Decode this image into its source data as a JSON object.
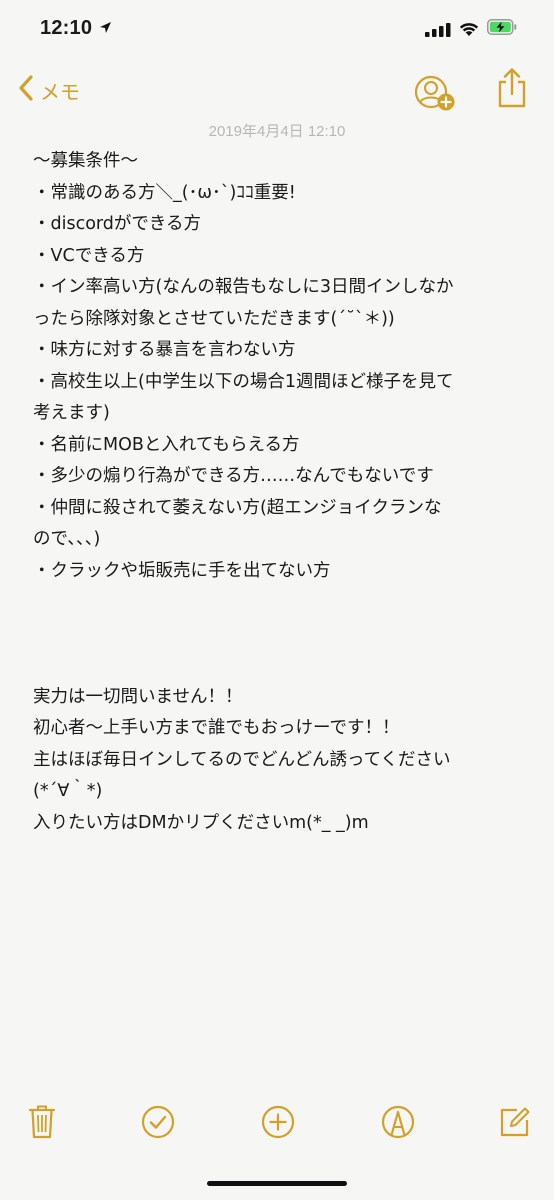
{
  "status_bar": {
    "time": "12:10",
    "icons": [
      "location-arrow-icon",
      "signal-bars-icon",
      "wifi-icon",
      "battery-charging-icon"
    ]
  },
  "nav": {
    "back_label": "メモ",
    "accent_color": "#d3a02a",
    "icons": [
      "chevron-left-icon",
      "add-people-icon",
      "share-icon"
    ]
  },
  "note": {
    "timestamp": "2019年4月4日 12:10",
    "lines": [
      "〜募集条件〜",
      "・常識のある方＼_(･ω･`)ｺｺ重要!",
      "・discordができる方",
      "・VCできる方",
      "・イン率高い方(なんの報告もなしに3日間インしなか",
      "ったら除隊対象とさせていただきます(´˘`＊))",
      "・味方に対する暴言を言わない方",
      "・高校生以上(中学生以下の場合1週間ほど様子を見て",
      "考えます)",
      "・名前にMOBと入れてもらえる方",
      "・多少の煽り行為ができる方……なんでもないです",
      "・仲間に殺されて萎えない方(超エンジョイクランな",
      "ので、、、)",
      "・クラックや垢販売に手を出てない方",
      "",
      "",
      "",
      "実力は一切問いません！！",
      "初心者〜上手い方まで誰でもおっけーです！！",
      "主はほぼ毎日インしてるのでどんどん誘ってください",
      "(*´∀｀*)",
      "入りたい方はDMかリプくださいm(*_ _)m"
    ]
  },
  "toolbar": {
    "icons": [
      "trash-icon",
      "checklist-icon",
      "add-icon",
      "markup-pen-icon",
      "compose-icon"
    ]
  }
}
